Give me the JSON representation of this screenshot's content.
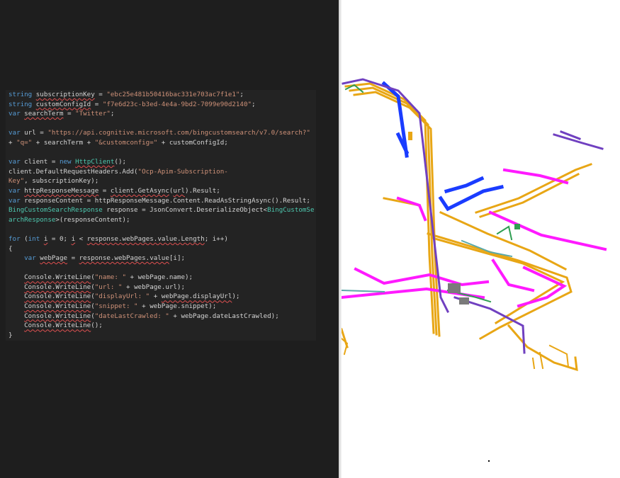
{
  "editor": {
    "lines": [
      [
        {
          "t": "string",
          "c": "kw"
        },
        {
          "t": " "
        },
        {
          "t": "subscriptionKey",
          "c": "var sq"
        },
        {
          "t": " = "
        },
        {
          "t": "\"ebc25e481b50416bac331e703ac7f1e1\"",
          "c": "str"
        },
        {
          "t": ";"
        }
      ],
      [
        {
          "t": "string",
          "c": "kw"
        },
        {
          "t": " "
        },
        {
          "t": "customConfigId",
          "c": "var sq"
        },
        {
          "t": " = "
        },
        {
          "t": "\"f7e6d23c-b3ed-4e4a-9bd2-7099e90d2140\"",
          "c": "str"
        },
        {
          "t": ";"
        }
      ],
      [
        {
          "t": "var",
          "c": "kw"
        },
        {
          "t": " "
        },
        {
          "t": "searchTerm",
          "c": "var sq"
        },
        {
          "t": " = "
        },
        {
          "t": "\"Twitter\"",
          "c": "str"
        },
        {
          "t": ";"
        }
      ],
      [],
      [
        {
          "t": "var",
          "c": "kw"
        },
        {
          "t": " url = "
        },
        {
          "t": "\"https://api.cognitive.microsoft.com/bingcustomsearch/v7.0/search?\"",
          "c": "str"
        }
      ],
      [
        {
          "t": "+ "
        },
        {
          "t": "\"q=\"",
          "c": "str"
        },
        {
          "t": " + searchTerm + "
        },
        {
          "t": "\"&customconfig=\"",
          "c": "str"
        },
        {
          "t": " + customConfigId;"
        }
      ],
      [],
      [
        {
          "t": "var",
          "c": "kw"
        },
        {
          "t": " client = "
        },
        {
          "t": "new",
          "c": "kw"
        },
        {
          "t": " "
        },
        {
          "t": "HttpClient",
          "c": "type sq"
        },
        {
          "t": "();"
        }
      ],
      [
        {
          "t": "client.DefaultRequestHeaders.Add("
        },
        {
          "t": "\"Ocp-Apim-Subscription-",
          "c": "str"
        }
      ],
      [
        {
          "t": "Key\"",
          "c": "str"
        },
        {
          "t": ", subscriptionKey);"
        }
      ],
      [
        {
          "t": "var",
          "c": "kw"
        },
        {
          "t": " "
        },
        {
          "t": "httpResponseMessage",
          "c": "var sq"
        },
        {
          "t": " = "
        },
        {
          "t": "client.GetAsync",
          "c": "var sq"
        },
        {
          "t": "("
        },
        {
          "t": "url",
          "c": "var sq"
        },
        {
          "t": ").Result;"
        }
      ],
      [
        {
          "t": "var",
          "c": "kw"
        },
        {
          "t": " responseContent = httpResponseMessage.Content.ReadAsStringAsync().Result;"
        }
      ],
      [
        {
          "t": "BingCustomSearchResponse",
          "c": "type"
        },
        {
          "t": " response = JsonConvert.DeserializeObject<"
        },
        {
          "t": "BingCustomSe",
          "c": "type"
        }
      ],
      [
        {
          "t": "archResponse",
          "c": "type"
        },
        {
          "t": ">(responseContent);"
        }
      ],
      [],
      [
        {
          "t": "for",
          "c": "kw"
        },
        {
          "t": " ("
        },
        {
          "t": "int",
          "c": "kw"
        },
        {
          "t": " "
        },
        {
          "t": "i",
          "c": "var sq"
        },
        {
          "t": " = 0; "
        },
        {
          "t": "i",
          "c": "var sq"
        },
        {
          "t": " < "
        },
        {
          "t": "response.webPages.value.Length",
          "c": "var sq"
        },
        {
          "t": "; i++)"
        }
      ],
      [
        {
          "t": "{"
        }
      ],
      [
        {
          "t": "    "
        },
        {
          "t": "var",
          "c": "kw"
        },
        {
          "t": " "
        },
        {
          "t": "webPage",
          "c": "var sq"
        },
        {
          "t": " = "
        },
        {
          "t": "response.webPages.value",
          "c": "var sq"
        },
        {
          "t": "[i];"
        }
      ],
      [],
      [
        {
          "t": "    "
        },
        {
          "t": "Console.WriteLine",
          "c": "var sq"
        },
        {
          "t": "("
        },
        {
          "t": "\"name: \"",
          "c": "str"
        },
        {
          "t": " + webPage.name);"
        }
      ],
      [
        {
          "t": "    "
        },
        {
          "t": "Console.WriteLine",
          "c": "var sq"
        },
        {
          "t": "("
        },
        {
          "t": "\"url: \"",
          "c": "str"
        },
        {
          "t": " + webPage.url);"
        }
      ],
      [
        {
          "t": "    "
        },
        {
          "t": "Console.WriteLine",
          "c": "var sq"
        },
        {
          "t": "("
        },
        {
          "t": "\"displayUrl: \"",
          "c": "str"
        },
        {
          "t": " + "
        },
        {
          "t": "webPage.displayUrl",
          "c": "var sq"
        },
        {
          "t": ");"
        }
      ],
      [
        {
          "t": "    "
        },
        {
          "t": "Console.WriteLine",
          "c": "var sq"
        },
        {
          "t": "("
        },
        {
          "t": "\"snippet: \"",
          "c": "str"
        },
        {
          "t": " + webPage.snippet);"
        }
      ],
      [
        {
          "t": "    "
        },
        {
          "t": "Console.WriteLine",
          "c": "var sq"
        },
        {
          "t": "("
        },
        {
          "t": "\"dateLastCrawled: \"",
          "c": "str"
        },
        {
          "t": " + webPage.dateLastCrawled);"
        }
      ],
      [
        {
          "t": "    "
        },
        {
          "t": "Console.WriteLine",
          "c": "var sq"
        },
        {
          "t": "();"
        }
      ],
      [
        {
          "t": "}"
        }
      ]
    ]
  },
  "colors": {
    "editor_bg": "#1e1e1e",
    "keyword": "#569cd6",
    "string": "#ce9178",
    "type": "#4ec9b0",
    "pipe_orange": "#e8a615",
    "pipe_magenta": "#ff1aff",
    "pipe_blue": "#1a3cff",
    "pipe_purple": "#7040c0"
  },
  "viewer": {
    "content": "3d-pipe-model"
  }
}
